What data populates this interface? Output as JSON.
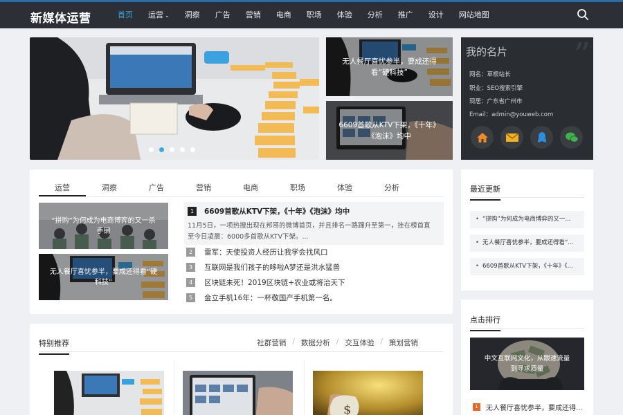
{
  "site": {
    "logo": "新媒体运营"
  },
  "nav": {
    "items": [
      {
        "label": "首页",
        "active": true
      },
      {
        "label": "运营",
        "dropdown": true
      },
      {
        "label": "洞察"
      },
      {
        "label": "广告"
      },
      {
        "label": "营销"
      },
      {
        "label": "电商"
      },
      {
        "label": "职场"
      },
      {
        "label": "体验"
      },
      {
        "label": "分析"
      },
      {
        "label": "推广"
      },
      {
        "label": "设计"
      },
      {
        "label": "网站地图"
      }
    ],
    "search_icon": "search-icon"
  },
  "slider": {
    "dot_count": 5,
    "active_dot": 2
  },
  "side_cards": [
    {
      "caption": "无人餐厅喜忧参半，要成还得看“硬科技”"
    },
    {
      "caption": "6609首歌从KTV下架，《十年》《泡沫》均中"
    }
  ],
  "name_card": {
    "title": "我的名片",
    "lines": [
      "网名：草根站长",
      "职业：SEO搜索引擎",
      "现居：广东省广州市",
      "Email：admin@youweb.com"
    ],
    "icons": [
      "home-icon",
      "mail-icon",
      "qq-icon",
      "wechat-icon"
    ]
  },
  "tabs": {
    "items": [
      "运营",
      "洞察",
      "广告",
      "营销",
      "电商",
      "职场",
      "体验",
      "分析"
    ],
    "active": 0
  },
  "tab_thumbs": [
    {
      "caption": "“拼购”为何成为电商博弈的又一杀手锏"
    },
    {
      "caption": "无人餐厅喜忧参半，要成还得看“硬科技”"
    }
  ],
  "featured": {
    "num": "1",
    "title": "6609首歌从KTV下架，《十年》《泡沫》均中",
    "desc": "11月5日，一项热搜出现在邦哥的微博首页，并且排名一路蹿升至第一，挂在榜首直至今日凌晨：6000多首歌从KTV下架。..."
  },
  "news": [
    {
      "num": "2",
      "title": "雷军：天使投资人经历让我学会找风口"
    },
    {
      "num": "3",
      "title": "互联网是我们孩子的哆啦A梦还是洪水猛兽"
    },
    {
      "num": "4",
      "title": "区块链未死！2019区块链+农业或将治天下"
    },
    {
      "num": "5",
      "title": "金立手机16年：一杯敬国产手机第一名。"
    }
  ],
  "recommend": {
    "title": "特别推荐",
    "links": [
      "社群营销",
      "数据分析",
      "交互体验",
      "策划营销"
    ]
  },
  "latest": {
    "title": "最近更新",
    "items": [
      "“拼购”为何成为电商博弈的又一...",
      "无人餐厅喜忧参半，要成还得看“...",
      "6609首歌从KTV下架，《十年》《..."
    ]
  },
  "ranking": {
    "title": "点击排行",
    "image_caption": "中文互联网文化，从跟速流量到寻求质量",
    "items": [
      {
        "num": "1",
        "title": "无人餐厅喜忧参半，要成还得..."
      }
    ]
  },
  "colors": {
    "accent": "#3ba8e0",
    "topbar": "#2c3036",
    "name_card": "#2a2d31",
    "rank_badge": "#e8682c"
  }
}
